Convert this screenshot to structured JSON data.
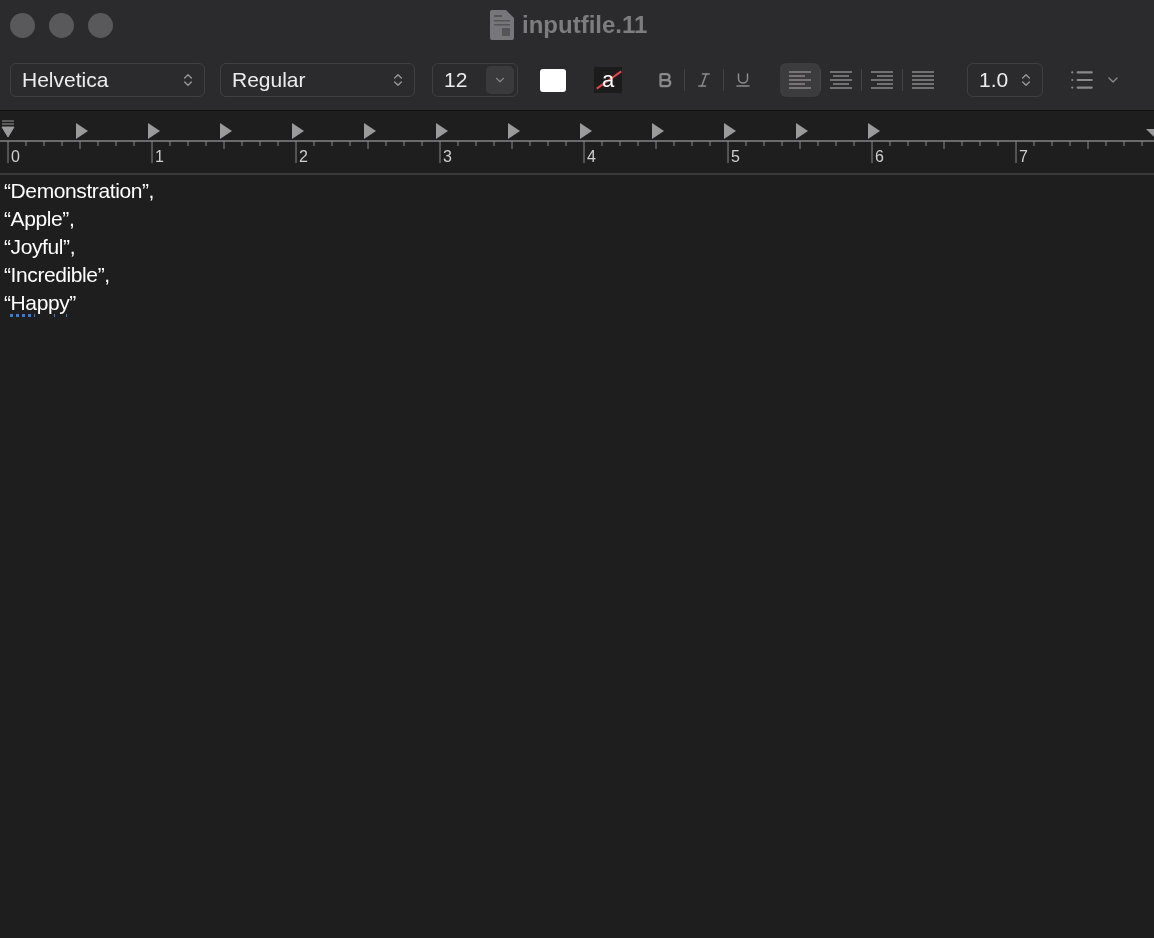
{
  "window": {
    "title": "inputfile.11"
  },
  "toolbar": {
    "font_family": "Helvetica",
    "font_style": "Regular",
    "font_size": "12",
    "background_glyph": "a",
    "line_spacing": "1.0",
    "alignments": [
      {
        "kind": "left",
        "selected": true
      },
      {
        "kind": "center",
        "selected": false
      },
      {
        "kind": "right",
        "selected": false
      },
      {
        "kind": "justify",
        "selected": false
      }
    ]
  },
  "ruler": {
    "labels": [
      "0",
      "1",
      "2",
      "3",
      "4",
      "5",
      "6",
      "7"
    ]
  },
  "document": {
    "lines": [
      {
        "open": "“",
        "word": "Demonstration",
        "close": "”,",
        "flagged": false
      },
      {
        "open": "“",
        "word": "Apple",
        "close": "”,",
        "flagged": false
      },
      {
        "open": "“",
        "word": "Joyful",
        "close": "”,",
        "flagged": false
      },
      {
        "open": "“",
        "word": "Incredible",
        "close": "”,",
        "flagged": false
      },
      {
        "open": "“",
        "word": "Happy",
        "close": "”",
        "flagged": true
      }
    ]
  }
}
